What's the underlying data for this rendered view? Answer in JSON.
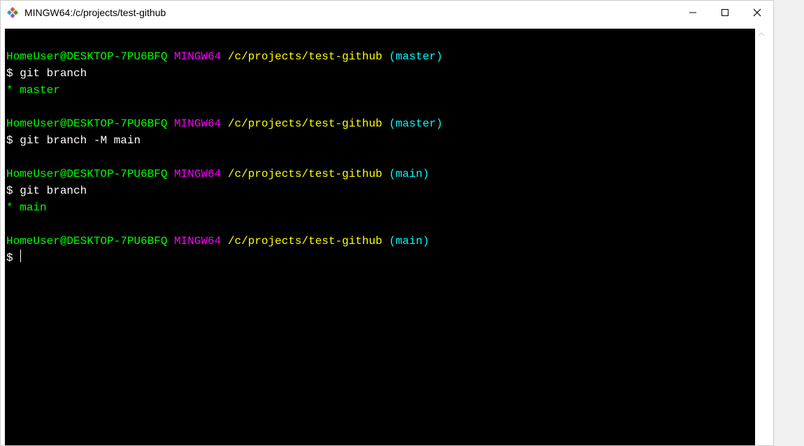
{
  "window": {
    "title": "MINGW64:/c/projects/test-github"
  },
  "prompt": {
    "user_host": "HomeUser@DESKTOP-7PU6BFQ",
    "app": "MINGW64",
    "path": "/c/projects/test-github",
    "symbol": "$"
  },
  "branches": {
    "master": "(master)",
    "main": "(main)"
  },
  "blocks": [
    {
      "branch_key": "master",
      "command": "git branch",
      "output_star": "*",
      "output_name": "master"
    },
    {
      "branch_key": "master",
      "command": "git branch -M main",
      "output_star": "",
      "output_name": ""
    },
    {
      "branch_key": "main",
      "command": "git branch",
      "output_star": "*",
      "output_name": "main"
    },
    {
      "branch_key": "main",
      "command": "",
      "output_star": "",
      "output_name": ""
    }
  ]
}
